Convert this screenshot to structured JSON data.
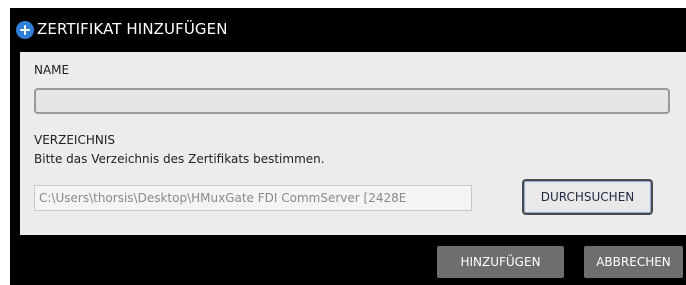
{
  "dialog": {
    "title": "ZERTIFIKAT HINZUFÜGEN",
    "icon": "plus-circle-icon",
    "accent_color": "#2f7fd8"
  },
  "form": {
    "name_label": "NAME",
    "name_value": "",
    "directory_label": "VERZEICHNIS",
    "directory_hint": "Bitte das Verzeichnis des Zertifikats bestimmen.",
    "directory_value": "C:\\Users\\thorsis\\Desktop\\HMuxGate FDI CommServer [2428E",
    "browse_label": "DURCHSUCHEN"
  },
  "footer": {
    "add_label": "HINZUFÜGEN",
    "cancel_label": "ABBRECHEN"
  }
}
